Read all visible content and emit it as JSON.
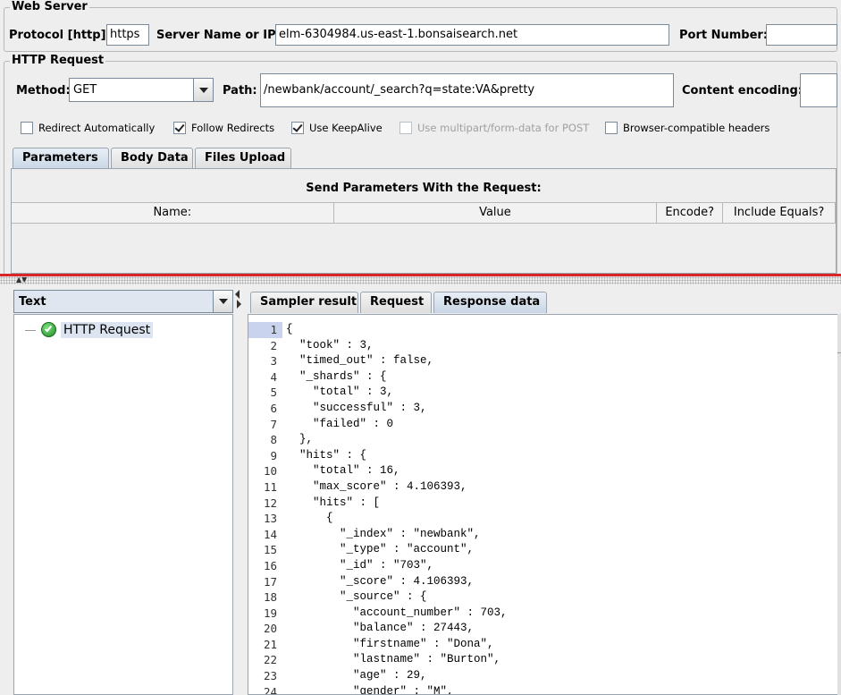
{
  "web_server": {
    "legend": "Web Server",
    "protocol_label": "Protocol [http]:",
    "protocol_value": "https",
    "server_label": "Server Name or IP:",
    "server_value": "elm-6304984.us-east-1.bonsaisearch.net",
    "port_label": "Port Number:",
    "port_value": ""
  },
  "http_request": {
    "legend": "HTTP Request",
    "method_label": "Method:",
    "method_value": "GET",
    "path_label": "Path:",
    "path_value": "/newbank/account/_search?q=state:VA&pretty",
    "encoding_label": "Content encoding:",
    "encoding_value": ""
  },
  "options": [
    {
      "label": "Redirect Automatically",
      "checked": false,
      "disabled": false
    },
    {
      "label": "Follow Redirects",
      "checked": true,
      "disabled": false
    },
    {
      "label": "Use KeepAlive",
      "checked": true,
      "disabled": false
    },
    {
      "label": "Use multipart/form-data for POST",
      "checked": false,
      "disabled": true
    },
    {
      "label": "Browser-compatible headers",
      "checked": false,
      "disabled": false
    }
  ],
  "request_tabs": [
    "Parameters",
    "Body Data",
    "Files Upload"
  ],
  "request_tabs_active": 0,
  "params": {
    "title": "Send Parameters With the Request:",
    "columns": [
      "Name:",
      "Value",
      "Encode?",
      "Include Equals?"
    ]
  },
  "renderer": {
    "selected": "Text"
  },
  "tree": {
    "items": [
      {
        "label": "HTTP Request",
        "status": "success"
      }
    ]
  },
  "result_tabs": [
    "Sampler result",
    "Request",
    "Response data"
  ],
  "result_tabs_active": 2,
  "response_lines": [
    "{",
    "  \"took\" : 3,",
    "  \"timed_out\" : false,",
    "  \"_shards\" : {",
    "    \"total\" : 3,",
    "    \"successful\" : 3,",
    "    \"failed\" : 0",
    "  },",
    "  \"hits\" : {",
    "    \"total\" : 16,",
    "    \"max_score\" : 4.106393,",
    "    \"hits\" : [",
    "      {",
    "        \"_index\" : \"newbank\",",
    "        \"_type\" : \"account\",",
    "        \"_id\" : \"703\",",
    "        \"_score\" : 4.106393,",
    "        \"_source\" : {",
    "          \"account_number\" : 703,",
    "          \"balance\" : 27443,",
    "          \"firstname\" : \"Dona\",",
    "          \"lastname\" : \"Burton\",",
    "          \"age\" : 29,",
    "          \"gender\" : \"M\","
  ],
  "colors": {
    "divider": "#d8262b",
    "active_tab": "#c9d6e6",
    "selection": "#dbe4f0"
  }
}
